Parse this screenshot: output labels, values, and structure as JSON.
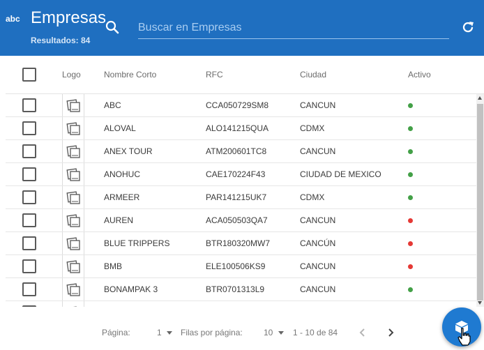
{
  "header": {
    "logo_text": "abc",
    "title": "Empresas",
    "results": "Resultados: 84",
    "search_placeholder": "Buscar en Empresas"
  },
  "table": {
    "columns": [
      "Logo",
      "Nombre Corto",
      "RFC",
      "Ciudad",
      "Activo"
    ],
    "rows": [
      {
        "name": "ABC",
        "rfc": "CCA050729SM8",
        "city": "CANCUN",
        "active": true
      },
      {
        "name": "ALOVAL",
        "rfc": "ALO141215QUA",
        "city": "CDMX",
        "active": true
      },
      {
        "name": "ANEX TOUR",
        "rfc": "ATM200601TC8",
        "city": "CANCUN",
        "active": true
      },
      {
        "name": "ANOHUC",
        "rfc": "CAE170224F43",
        "city": "CIUDAD DE MEXICO",
        "active": true
      },
      {
        "name": "ARMEER",
        "rfc": "PAR141215UK7",
        "city": "CDMX",
        "active": true
      },
      {
        "name": "AUREN",
        "rfc": "ACA050503QA7",
        "city": "CANCUN",
        "active": false
      },
      {
        "name": "BLUE TRIPPERS",
        "rfc": "BTR180320MW7",
        "city": "CANCÚN",
        "active": false
      },
      {
        "name": "BMB",
        "rfc": "ELE100506KS9",
        "city": "CANCUN",
        "active": false
      },
      {
        "name": "BONAMPAK 3",
        "rfc": "BTR0701313L9",
        "city": "CANCUN",
        "active": true
      }
    ]
  },
  "footer": {
    "page_label": "Página:",
    "page_value": "1",
    "per_page_label": "Filas por página:",
    "per_page_value": "10",
    "range": "1 - 10 de 84"
  },
  "colors": {
    "header": "#1f6fc0",
    "active": "#43a047",
    "inactive": "#e53935"
  }
}
